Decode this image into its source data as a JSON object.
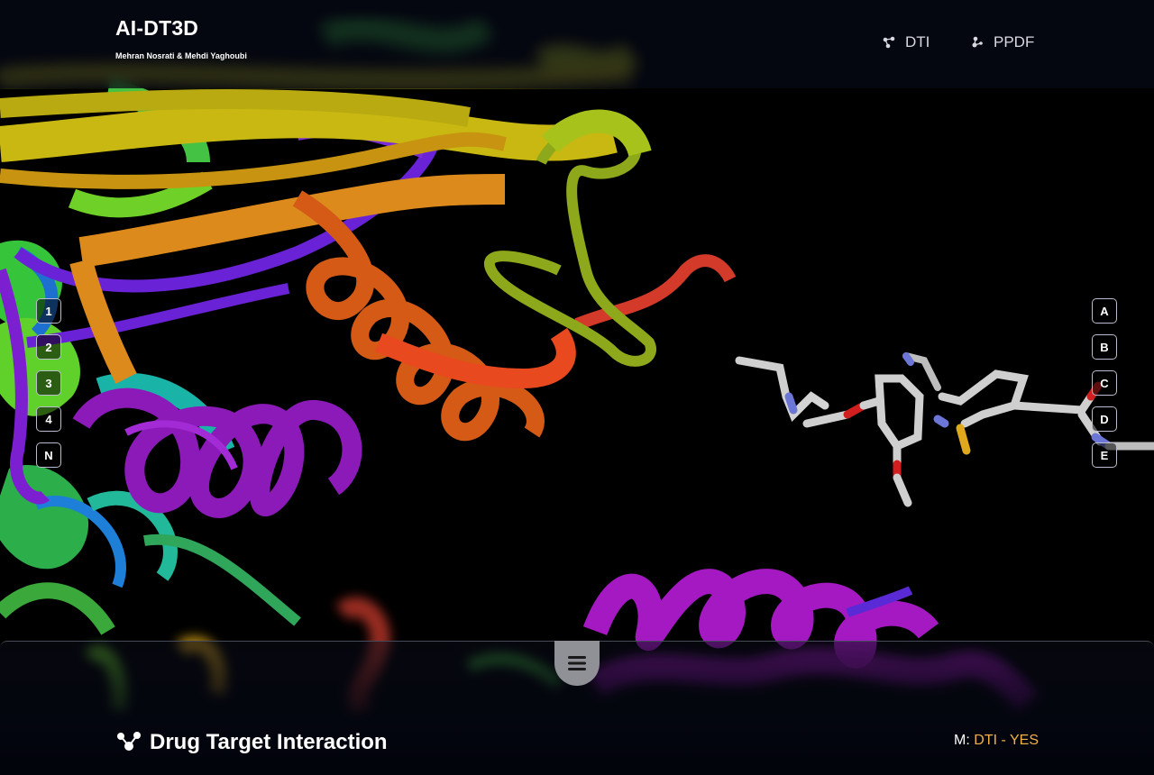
{
  "header": {
    "title": "AI-DT3D",
    "subtitle": "Mehran Nosrati & Mehdi Yaghoubi",
    "nav": [
      {
        "label": "DTI",
        "icon": "molecule-icon"
      },
      {
        "label": "PPDF",
        "icon": "molecule-alt-icon"
      }
    ]
  },
  "left_controls": [
    "1",
    "2",
    "3",
    "4",
    "N"
  ],
  "right_controls": [
    "A",
    "B",
    "C",
    "D",
    "E"
  ],
  "footer": {
    "menu_icon": "hamburger-icon",
    "title": "Drug Target Interaction",
    "title_icon": "molecule-icon",
    "mode_label": "M:",
    "mode_value": "DTI - YES"
  },
  "colors": {
    "accent": "#f3b04a",
    "background": "#000000",
    "panel": "#050916"
  }
}
